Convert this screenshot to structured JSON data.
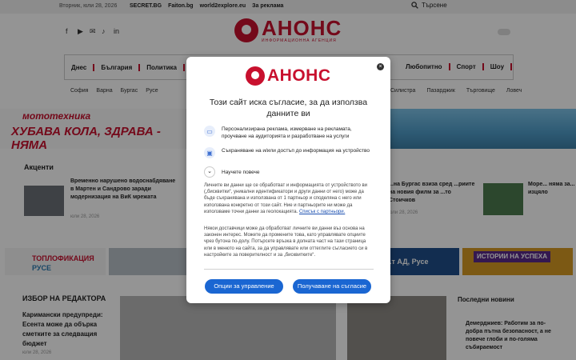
{
  "topbar": {
    "date": "Вторник, юли 28, 2026",
    "links": [
      "SECRET.BG",
      "Faiton.bg",
      "world2explore.eu",
      "За реклама"
    ],
    "search_label": "Търсене"
  },
  "brand": {
    "name": "АНОНС",
    "tagline": "ИНФОРМАЦИОННА АГЕНЦИЯ"
  },
  "social_icons": [
    "facebook-icon",
    "youtube-icon",
    "email-icon",
    "tiktok-icon",
    "linkedin-icon"
  ],
  "nav": {
    "items": [
      "Днес",
      "България",
      "Политика"
    ],
    "right_items": [
      "Любопитно",
      "Спорт",
      "Шоу"
    ]
  },
  "subnav": {
    "left": [
      "София",
      "Варна",
      "Бургас",
      "Русе"
    ],
    "right": [
      "Силистра",
      "Пазарджик",
      "Търговище",
      "Ловеч"
    ]
  },
  "banner1": {
    "line1": "мототехника",
    "line2": "ХУБАВА КОЛА, ЗДРАВА - НЯМА"
  },
  "sections": {
    "news_title": "Акценти",
    "editor_title": "ИЗБОР НА РЕДАКТОРА",
    "latest_title": "Последни новини"
  },
  "news": {
    "left_text": "Временно нарушено водоснабдяване в Мартен и Сандрово заради модернизация на ВиК мрежата",
    "left_date": "юли 28, 2026",
    "mid_text": "...на Бургас взиза сред ...риите на новия филм за ...то Стоичков",
    "mid_date": "юли 28, 2026",
    "right_text": "Море... няма за... изцяло",
    "right_date": "юли 28, 2..."
  },
  "banner2": {
    "heating_1": "ТОПЛОФИКАЦИЯ",
    "heating_2": "РУСЕ",
    "ad_text": "...т АД, Русе",
    "history": "ИСТОРИИ НА УСПЕХА"
  },
  "editor": {
    "text": "Каримански предупреди: Есента може да обърка сметките за следващия бюджет",
    "date": "юли 28, 2026"
  },
  "latest": {
    "text": "Демерджиев: Работим за по-добра пътна безопасност, а не повече глоби и по-голяма събираемост"
  },
  "dialog": {
    "title": "Този сайт иска съгласие, за да използва данните ви",
    "purposes": [
      {
        "icon": "monitor-icon",
        "text": "Персонализирана реклама, измерване на рекламата, проучване на аудиторията и разработване на услуги"
      },
      {
        "icon": "device-storage-icon",
        "text": "Съхраняване на и/или достъп до информация на устройство"
      }
    ],
    "more_label": "Научете повече",
    "body1": "Личните ви данни ще се обработват и информацията от устройството ви („бисквитки“, уникални идентификатори и други данни от него) може да бъде съхранявана и използвана от 1 партньор и споделяна с него или използвана конкретно от този сайт. Ние и партньорите ни може да използваме точни данни за геолокацията.",
    "partners_link": "Списък с партньори.",
    "body2": "Някои доставчици може да обработват личните ви данни въз основа на законен интерес. Можете да промените това, като управлявате опциите чрез бутона по-долу. Потърсете връзка в долната част на тази страница или в менюто на сайта, за да управлявате или оттеглите съгласието си в настройките за поверителност и за „бисквитките“.",
    "manage_label": "Опции за управление",
    "consent_label": "Получаване на съгласие",
    "close_symbol": "×"
  }
}
